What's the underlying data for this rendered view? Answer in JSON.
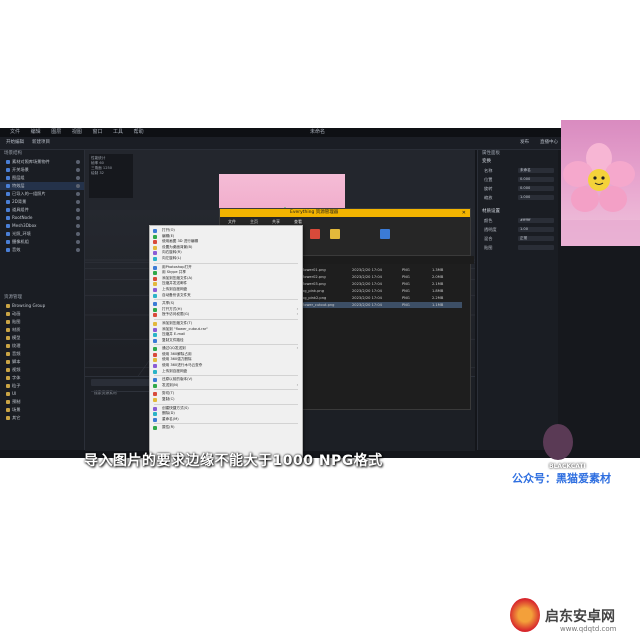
{
  "menubar": {
    "items": [
      "文件",
      "编辑",
      "图层",
      "视图",
      "窗口",
      "工具",
      "帮助"
    ],
    "center": "未命名"
  },
  "toolbar": {
    "items": [
      "开始编辑",
      "新建项目"
    ],
    "right": [
      "发布",
      "直播中心",
      "GPU模式",
      "帮助"
    ]
  },
  "left_panel": {
    "title": "场景结构",
    "tree": [
      {
        "label": "素材对照库场景物件"
      },
      {
        "label": "开关场景"
      },
      {
        "label": "图层组"
      },
      {
        "label": "特效层",
        "selected": true
      },
      {
        "label": "已导入的一组照片"
      },
      {
        "label": "2D背景"
      },
      {
        "label": "道具组件"
      },
      {
        "label": "RootNode"
      },
      {
        "label": "Mesh3Dbox"
      },
      {
        "label": "光照_环境"
      },
      {
        "label": "摄像机组"
      },
      {
        "label": "音效"
      }
    ],
    "assets_title": "资源管理",
    "assets": [
      "Browsing Group",
      "动画",
      "贴图",
      "材质",
      "模型",
      "纹理",
      "音频",
      "脚本",
      "视频",
      "字体",
      "粒子",
      "UI",
      "预制",
      "场景",
      "其它"
    ]
  },
  "viewport": {
    "stats_title": "性能统计",
    "stats": [
      "帧率 60",
      "三角面 1250",
      "绘制 32"
    ]
  },
  "timeline": {
    "search_placeholder": "搜索资源素材"
  },
  "right_panel": {
    "title": "属性面板",
    "section1": "变换",
    "rows": [
      {
        "label": "名称",
        "value": "未命名"
      },
      {
        "label": "位置",
        "value": "0.000"
      },
      {
        "label": "旋转",
        "value": "0.000"
      },
      {
        "label": "缩放",
        "value": "1.000"
      }
    ],
    "section2": "材质设置",
    "rows2": [
      {
        "label": "颜色",
        "value": "#ffffff"
      },
      {
        "label": "透明度",
        "value": "1.00"
      },
      {
        "label": "混合",
        "value": "正常"
      },
      {
        "label": "贴图",
        "value": ""
      }
    ]
  },
  "explorer": {
    "title": "Everything 资源管理器",
    "tabs": [
      "文件",
      "主页",
      "共享",
      "查看"
    ],
    "address": "此电脑 > 桌面 > 素材 > 2023素材",
    "files": [
      {
        "name": "flower01.png",
        "date": "2023/2/20 17:04",
        "type": "PNG",
        "size": "1.3MB"
      },
      {
        "name": "flower02.png",
        "date": "2023/2/20 17:04",
        "type": "PNG",
        "size": "2.0MB"
      },
      {
        "name": "flower03.png",
        "date": "2023/2/20 17:04",
        "type": "PNG",
        "size": "2.1MB"
      },
      {
        "name": "bg_pink.png",
        "date": "2023/2/20 17:04",
        "type": "PNG",
        "size": "1.8MB"
      },
      {
        "name": "bg_pink2.png",
        "date": "2023/2/20 17:04",
        "type": "PNG",
        "size": "2.2MB"
      },
      {
        "name": "flower_cutout.png",
        "date": "2023/2/20 17:04",
        "type": "PNG",
        "size": "1.1MB",
        "selected": true
      }
    ]
  },
  "context_menu": {
    "items": [
      {
        "label": "打开(O)",
        "group": 1
      },
      {
        "label": "编辑(E)",
        "group": 1
      },
      {
        "label": "使用画图 3D 进行编辑",
        "group": 1
      },
      {
        "label": "设置为桌面背景(B)",
        "group": 1
      },
      {
        "label": "向右旋转(R)",
        "group": 1
      },
      {
        "label": "向左旋转(L)",
        "group": 1
      },
      {
        "label": "用Photoshop打开",
        "group": 2
      },
      {
        "label": "用 Skype 共享",
        "group": 2
      },
      {
        "label": "添加到压缩文件(A)",
        "group": 2
      },
      {
        "label": "压缩并发送邮件",
        "group": 2
      },
      {
        "label": "上传到百度网盘",
        "group": 2
      },
      {
        "label": "自动备份该文件夹",
        "group": 2
      },
      {
        "label": "共享(S)",
        "group": 3
      },
      {
        "label": "打开方式(H)",
        "group": 3,
        "sub": true
      },
      {
        "label": "授予访问权限(G)",
        "group": 3,
        "sub": true
      },
      {
        "label": "添加到压缩文件(T)",
        "group": 4
      },
      {
        "label": "添加到 \"flower_cutout.rar\"",
        "group": 4
      },
      {
        "label": "压缩并 E-mail",
        "group": 4
      },
      {
        "label": "复制文件路径",
        "group": 4
      },
      {
        "label": "通过QQ发送到",
        "group": 5,
        "sub": true
      },
      {
        "label": "使用 360解除占用",
        "group": 5
      },
      {
        "label": "使用 360强力删除",
        "group": 5
      },
      {
        "label": "使用 360进行木马云查杀",
        "group": 5
      },
      {
        "label": "上传到百度网盘",
        "group": 5
      },
      {
        "label": "还原以前的版本(V)",
        "group": 6
      },
      {
        "label": "发送到(N)",
        "group": 6,
        "sub": true
      },
      {
        "label": "剪切(T)",
        "group": 7
      },
      {
        "label": "复制(C)",
        "group": 7
      },
      {
        "label": "创建快捷方式(S)",
        "group": 8
      },
      {
        "label": "删除(D)",
        "group": 8
      },
      {
        "label": "重命名(M)",
        "group": 8
      },
      {
        "label": "属性(R)",
        "group": 9
      }
    ]
  },
  "overlay": {
    "subtitle": "导入图片的要求边缘不能大于1000     NPG格式",
    "wechat": "公众号：黑猫爱素材",
    "channel": "BLACKCATI",
    "watermark_main": "启东安卓网",
    "watermark_sub": "www.qdqtd.com"
  },
  "colors": {
    "accent": "#2f6fe0",
    "explorer_title": "#f2b400",
    "app_bg": "#14161b"
  }
}
